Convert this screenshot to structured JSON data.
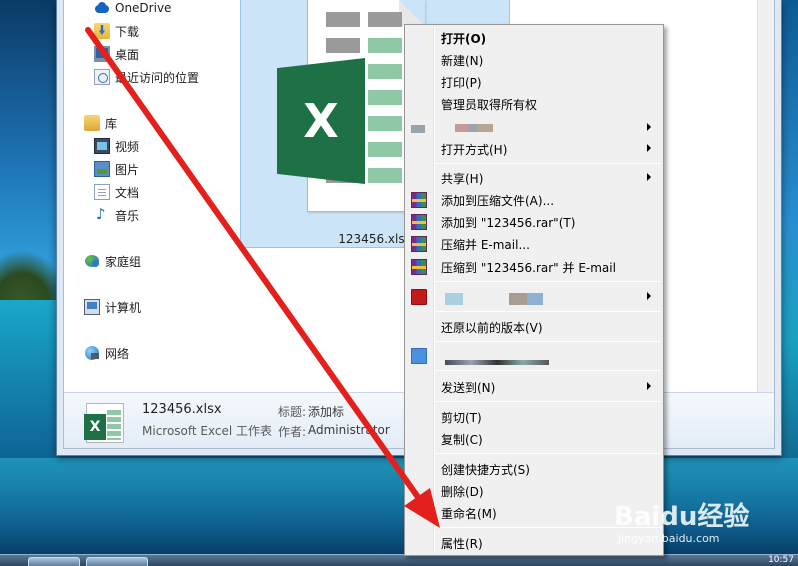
{
  "nav": {
    "items": [
      {
        "label": "OneDrive",
        "icon": "onedrive-icon"
      },
      {
        "label": "下载",
        "icon": "downloads-icon"
      },
      {
        "label": "桌面",
        "icon": "desktop-icon"
      },
      {
        "label": "最近访问的位置",
        "icon": "recent-places-icon"
      },
      {
        "label": "库",
        "icon": "libraries-icon"
      },
      {
        "label": "视频",
        "icon": "videos-icon"
      },
      {
        "label": "图片",
        "icon": "pictures-icon"
      },
      {
        "label": "文档",
        "icon": "documents-icon"
      },
      {
        "label": "音乐",
        "icon": "music-icon"
      },
      {
        "label": "家庭组",
        "icon": "homegroup-icon"
      },
      {
        "label": "计算机",
        "icon": "computer-icon"
      },
      {
        "label": "网络",
        "icon": "network-icon"
      }
    ]
  },
  "file": {
    "name": "123456.xlsx",
    "badge_letter": "X"
  },
  "details": {
    "name": "123456.xlsx",
    "type": "Microsoft Excel 工作表",
    "tag_key": "标题:",
    "tag_val": "添加标",
    "author_key": "作者:",
    "author_val": "Administrator"
  },
  "context_menu": {
    "items": [
      {
        "label": "打开(O)",
        "bold": true
      },
      {
        "label": "新建(N)"
      },
      {
        "label": "打印(P)"
      },
      {
        "label": "管理员取得所有权"
      },
      {
        "label": "打开方式(H)",
        "submenu": true
      },
      {
        "label": "共享(H)",
        "submenu": true
      },
      {
        "label": "添加到压缩文件(A)...",
        "icon": "winrar-icon"
      },
      {
        "label": "添加到 \"123456.rar\"(T)",
        "icon": "winrar-icon"
      },
      {
        "label": "压缩并 E-mail...",
        "icon": "winrar-icon"
      },
      {
        "label": "压缩到 \"123456.rar\" 并 E-mail",
        "icon": "winrar-icon"
      },
      {
        "label": "还原以前的版本(V)"
      },
      {
        "label": "发送到(N)",
        "submenu": true
      },
      {
        "label": "剪切(T)"
      },
      {
        "label": "复制(C)"
      },
      {
        "label": "创建快捷方式(S)"
      },
      {
        "label": "删除(D)"
      },
      {
        "label": "重命名(M)"
      },
      {
        "label": "属性(R)"
      }
    ]
  },
  "taskbar": {
    "clock": "10:57"
  },
  "watermark": {
    "main": "Baidu经验",
    "sub": "jingyan.baidu.com"
  },
  "colors": {
    "excel_green": "#1e7145",
    "arrow_red": "#e3201b",
    "selection_blue": "#cce4f7"
  }
}
